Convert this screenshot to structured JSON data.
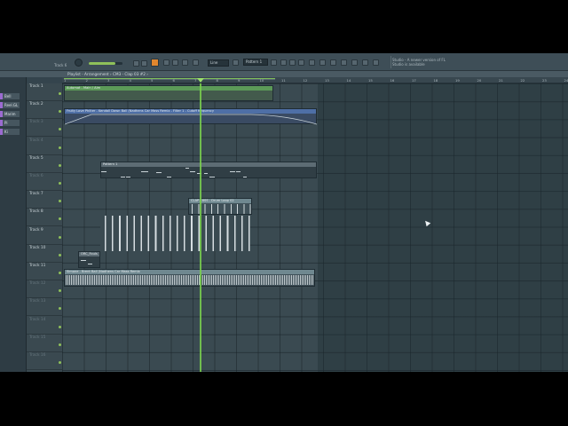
{
  "toolbar": {
    "track_readout": "Track 6",
    "snap_value": "Line",
    "pattern_name": "Pattern 1",
    "hint_title": "Studio - A newer version of FL",
    "hint_text": "Studio is available"
  },
  "playlist": {
    "title": "Playlist - Arrangement › CM3 - Clap 03 #2 ›"
  },
  "pickers": [
    "Bell",
    "Reel.GL",
    "Marim",
    "Pi",
    "Ki"
  ],
  "ruler": [
    "1",
    "2",
    "3",
    "4",
    "5",
    "6",
    "7",
    "8",
    "9",
    "10",
    "11",
    "12",
    "13",
    "14",
    "15",
    "16",
    "17",
    "18",
    "19",
    "20",
    "21",
    "22",
    "23",
    "24"
  ],
  "tracks": [
    {
      "label": "Track 1",
      "dim": false
    },
    {
      "label": "Track 2",
      "dim": false
    },
    {
      "label": "Track 3",
      "dim": true
    },
    {
      "label": "Track 4",
      "dim": true
    },
    {
      "label": "Track 5",
      "dim": false
    },
    {
      "label": "Track 6",
      "dim": true
    },
    {
      "label": "Track 7",
      "dim": false
    },
    {
      "label": "Track 8",
      "dim": false
    },
    {
      "label": "Track 9",
      "dim": false
    },
    {
      "label": "Track 10",
      "dim": false
    },
    {
      "label": "Track 11",
      "dim": false
    },
    {
      "label": "Track 12",
      "dim": true
    },
    {
      "label": "Track 13",
      "dim": true
    },
    {
      "label": "Track 14",
      "dim": true
    },
    {
      "label": "Track 15",
      "dim": true
    },
    {
      "label": "Track 16",
      "dim": true
    }
  ],
  "clips": {
    "track1": "Automat - Main / Aim",
    "track2": "Fruity Love Philter - Kendall Dawn Ball (Nadhens Car Mass Remix - Filter 1 - Cutoff frequency",
    "track5": "Pattern 1",
    "track7": "CLAP-16SS - Drum Loop 02",
    "track10": "ORC_Fouls",
    "track11": "Simone - Brent Ball (Nadhens Car Mass Remix"
  },
  "colors": {
    "accent": "#e0862e",
    "playhead": "#7ad14e",
    "grid_bg": "#3a4a51"
  }
}
